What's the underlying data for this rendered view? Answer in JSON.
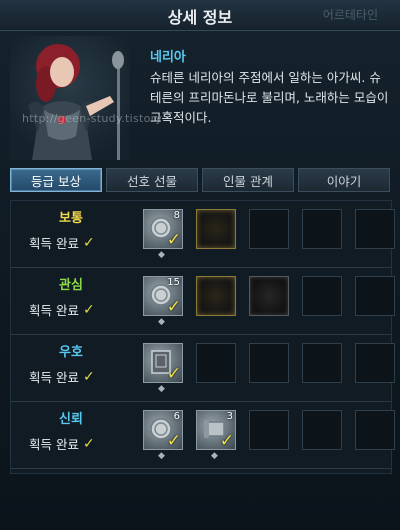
{
  "window": {
    "title": "상세 정보",
    "ghost_tab": "어르테타인"
  },
  "character": {
    "name": "네리아",
    "description": "슈테른 네리아의 주점에서 일하는 아가씨. 슈테른의 프리마돈나로 불리며, 노래하는 모습이 고혹적이다.",
    "watermark": "http://geen-study.tistory"
  },
  "tabs": [
    {
      "label": "등급 보상",
      "active": true
    },
    {
      "label": "선호 선물",
      "active": false
    },
    {
      "label": "인물 관계",
      "active": false
    },
    {
      "label": "이야기",
      "active": false
    }
  ],
  "rows": [
    {
      "label": "보통",
      "label_color": "#f2d94b",
      "status": "획득 완료",
      "slots": [
        {
          "type": "item",
          "icon": "silver-coin-icon",
          "count": "8",
          "claimed": true
        },
        {
          "type": "glow"
        },
        {
          "type": "empty"
        },
        {
          "type": "empty"
        },
        {
          "type": "empty"
        }
      ]
    },
    {
      "label": "관심",
      "label_color": "#8ed94a",
      "status": "획득 완료",
      "slots": [
        {
          "type": "item",
          "icon": "silver-coin-icon",
          "count": "15",
          "claimed": true
        },
        {
          "type": "glow"
        },
        {
          "type": "glow-dim"
        },
        {
          "type": "empty"
        },
        {
          "type": "empty"
        }
      ]
    },
    {
      "label": "우호",
      "label_color": "#58c8f0",
      "status": "획득 완료",
      "slots": [
        {
          "type": "item",
          "icon": "book-icon",
          "count": "",
          "claimed": true
        },
        {
          "type": "empty"
        },
        {
          "type": "empty"
        },
        {
          "type": "empty"
        },
        {
          "type": "empty"
        }
      ]
    },
    {
      "label": "신뢰",
      "label_color": "#58c8f0",
      "status": "획득 완료",
      "slots": [
        {
          "type": "item",
          "icon": "silver-coin-icon",
          "count": "6",
          "claimed": true
        },
        {
          "type": "item",
          "icon": "scroll-icon",
          "count": "3",
          "claimed": true
        },
        {
          "type": "empty"
        },
        {
          "type": "empty"
        },
        {
          "type": "empty"
        }
      ]
    }
  ]
}
